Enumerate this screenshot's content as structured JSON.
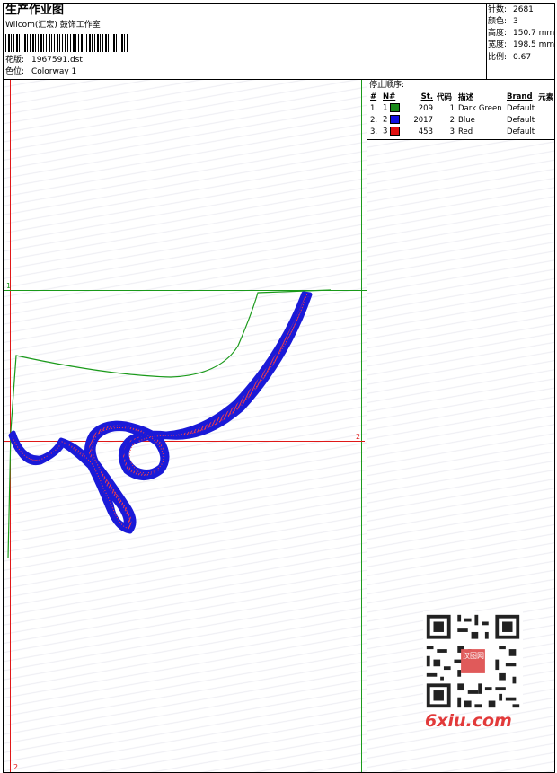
{
  "header": {
    "title": "生产作业图",
    "company": "Wilcom(汇宏) 鼓饰工作室",
    "design_label": "花版:",
    "design_value": "1967591.dst",
    "colorway_label": "色位:",
    "colorway_value": "Colorway 1"
  },
  "stats": {
    "stitches_label": "针数:",
    "stitches_value": "2681",
    "colors_label": "颜色:",
    "colors_value": "3",
    "height_label": "高度:",
    "height_value": "150.7 mm",
    "width_label": "宽度:",
    "width_value": "198.5 mm",
    "scale_label": "比例:",
    "scale_value": "0.67"
  },
  "stop_sequence": {
    "title": "停止顺序:",
    "headers": [
      "#",
      "N#",
      "St.",
      "代码",
      "描述",
      "Brand",
      "元素"
    ],
    "rows": [
      {
        "idx": "1.",
        "n": "1",
        "st": "209",
        "code": "1",
        "desc": "Dark Green",
        "brand": "Default",
        "color": "#1a8a1a"
      },
      {
        "idx": "2.",
        "n": "2",
        "st": "2017",
        "code": "2",
        "desc": "Blue",
        "brand": "Default",
        "color": "#1010e0"
      },
      {
        "idx": "3.",
        "n": "3",
        "st": "453",
        "code": "3",
        "desc": "Red",
        "brand": "Default",
        "color": "#e01010"
      }
    ]
  },
  "markers": {
    "m1": "1",
    "m2_right": "2",
    "m2_bottom": "2"
  },
  "watermark": {
    "logo": "6xiu.com",
    "seal": "汉图网"
  },
  "colors": {
    "green": "#1a9a1a",
    "blue": "#1a1ad8",
    "red": "#e01818"
  }
}
